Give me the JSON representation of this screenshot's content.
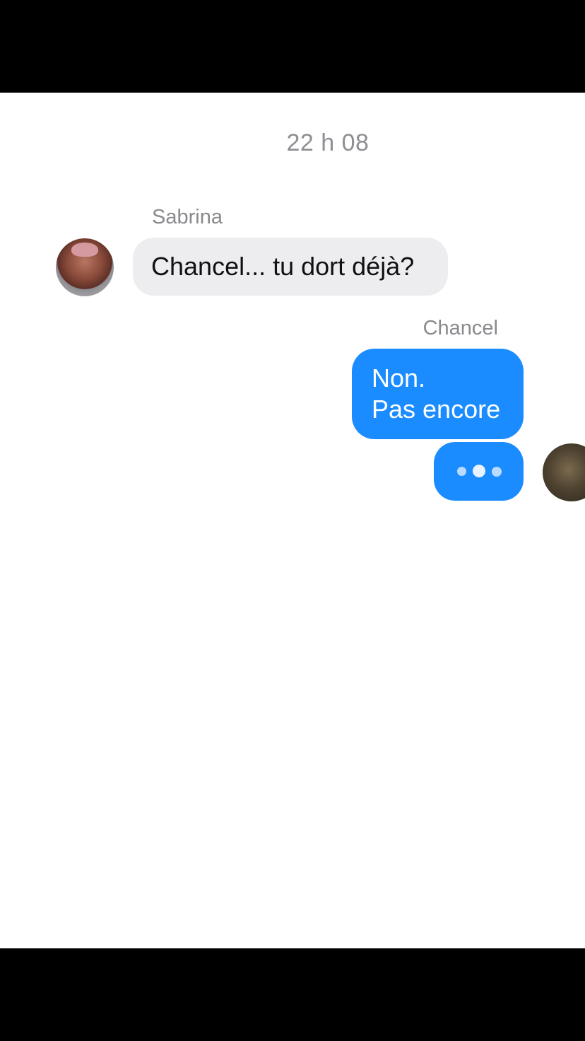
{
  "conversation": {
    "timestamp": "22 h 08",
    "messages": [
      {
        "sender": "Sabrina",
        "direction": "incoming",
        "text": "Chancel... tu dort déjà?",
        "avatar": "sabrina-avatar"
      },
      {
        "sender": "Chancel",
        "direction": "outgoing",
        "lines": [
          "Non.",
          "Pas encore"
        ],
        "avatar": "chancel-avatar"
      }
    ],
    "typing_indicator": {
      "sender": "Chancel",
      "icon": "typing-dots-icon"
    }
  },
  "colors": {
    "outgoing_bubble": "#1a8cff",
    "incoming_bubble": "#ededf0",
    "timestamp_text": "#8e8e93",
    "background": "#ffffff"
  }
}
